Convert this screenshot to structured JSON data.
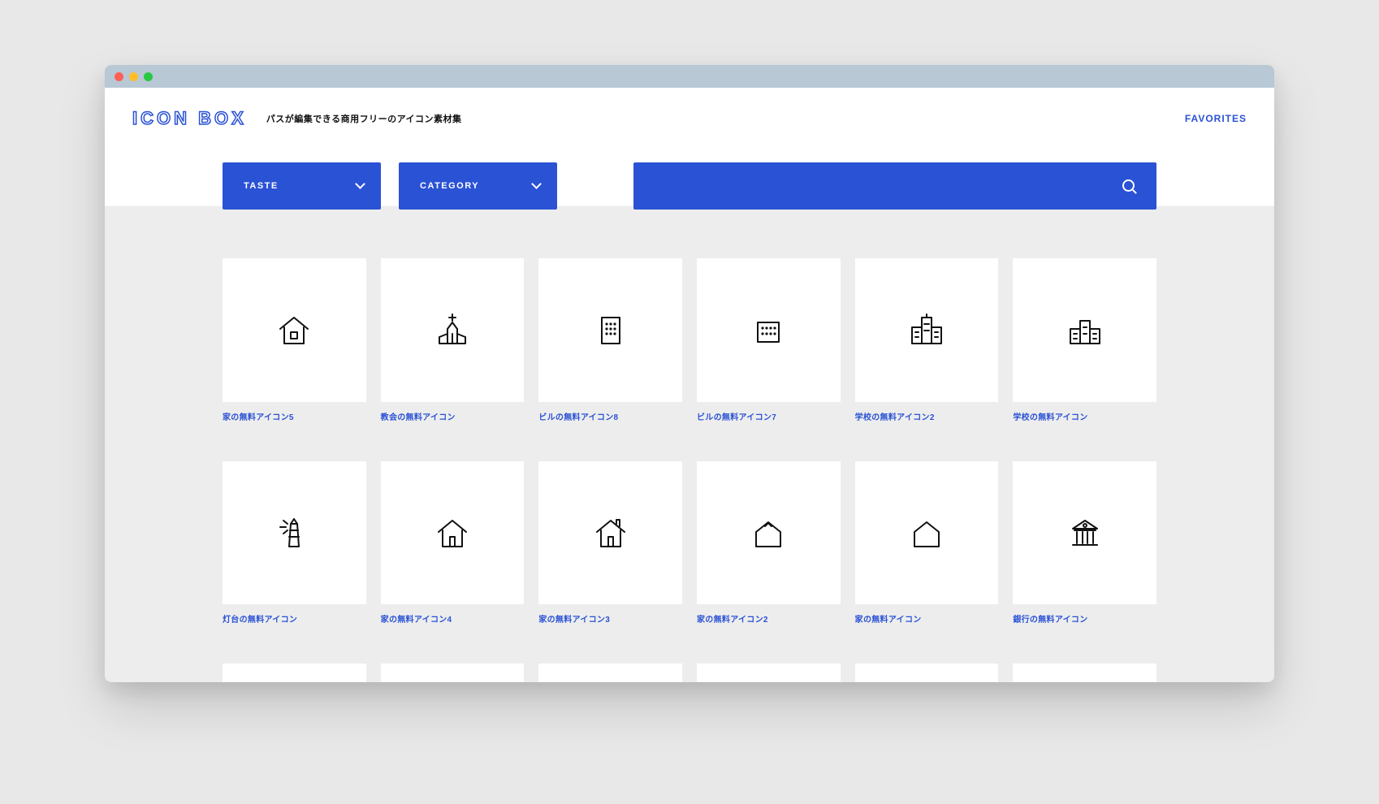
{
  "header": {
    "logo": "ICON BOX",
    "tagline": "パスが編集できる商用フリーのアイコン素材集",
    "favorites_label": "FAVORITES"
  },
  "filters": {
    "taste_label": "TASTE",
    "category_label": "CATEGORY",
    "search_value": ""
  },
  "icons": [
    {
      "label": "家の無料アイコン5",
      "glyph": "house-window"
    },
    {
      "label": "教会の無料アイコン",
      "glyph": "church"
    },
    {
      "label": "ビルの無料アイコン8",
      "glyph": "building-a"
    },
    {
      "label": "ビルの無料アイコン7",
      "glyph": "building-b"
    },
    {
      "label": "学校の無料アイコン2",
      "glyph": "school-a"
    },
    {
      "label": "学校の無料アイコン",
      "glyph": "school-b"
    },
    {
      "label": "灯台の無料アイコン",
      "glyph": "lighthouse"
    },
    {
      "label": "家の無料アイコン4",
      "glyph": "house-door"
    },
    {
      "label": "家の無料アイコン3",
      "glyph": "house-chimney"
    },
    {
      "label": "家の無料アイコン2",
      "glyph": "house-outline"
    },
    {
      "label": "家の無料アイコン",
      "glyph": "house-simple"
    },
    {
      "label": "銀行の無料アイコン",
      "glyph": "bank"
    }
  ],
  "colors": {
    "accent": "#2a52d5"
  }
}
